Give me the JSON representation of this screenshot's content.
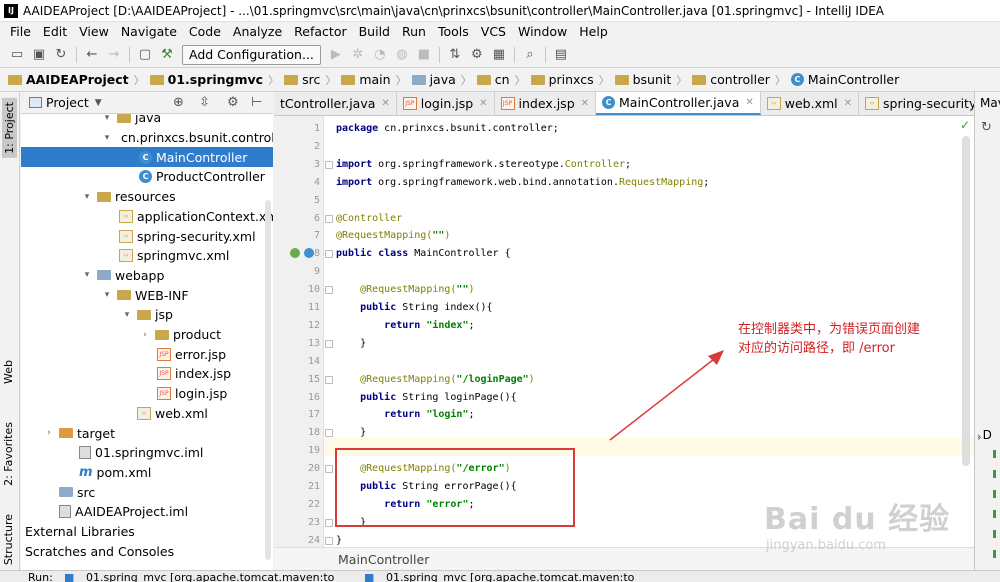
{
  "window": {
    "title": "AAIDEAProject [D:\\AAIDEAProject] - ...\\01.springmvc\\src\\main\\java\\cn\\prinxcs\\bsunit\\controller\\MainController.java [01.springmvc] - IntelliJ IDEA"
  },
  "menu": [
    "File",
    "Edit",
    "View",
    "Navigate",
    "Code",
    "Analyze",
    "Refactor",
    "Build",
    "Run",
    "Tools",
    "VCS",
    "Window",
    "Help"
  ],
  "toolbar": {
    "add_config": "Add Configuration..."
  },
  "breadcrumbs": [
    "AAIDEAProject",
    "01.springmvc",
    "src",
    "main",
    "java",
    "cn",
    "prinxcs",
    "bsunit",
    "controller",
    "MainController"
  ],
  "left_strip": {
    "project": "1: Project",
    "web": "Web",
    "favorites": "2: Favorites",
    "structure": "Z: Structure"
  },
  "project_panel": {
    "title": "Project"
  },
  "tree": [
    {
      "label": "java",
      "arrow": "▾",
      "indent": 60,
      "icon": "folder"
    },
    {
      "label": "cn.prinxcs.bsunit.controller",
      "arrow": "▾",
      "indent": 60,
      "icon": "folder"
    },
    {
      "label": "MainController",
      "arrow": "",
      "indent": 82,
      "icon": "class",
      "selected": true
    },
    {
      "label": "ProductController",
      "arrow": "",
      "indent": 82,
      "icon": "class"
    },
    {
      "label": "resources",
      "arrow": "▾",
      "indent": 40,
      "icon": "folder"
    },
    {
      "label": "applicationContext.xml",
      "arrow": "",
      "indent": 62,
      "icon": "xml"
    },
    {
      "label": "spring-security.xml",
      "arrow": "",
      "indent": 62,
      "icon": "xml"
    },
    {
      "label": "springmvc.xml",
      "arrow": "",
      "indent": 62,
      "icon": "xml"
    },
    {
      "label": "webapp",
      "arrow": "▾",
      "indent": 40,
      "icon": "folder-blue"
    },
    {
      "label": "WEB-INF",
      "arrow": "▾",
      "indent": 60,
      "icon": "folder"
    },
    {
      "label": "jsp",
      "arrow": "▾",
      "indent": 80,
      "icon": "folder"
    },
    {
      "label": "product",
      "arrow": "›",
      "indent": 98,
      "icon": "folder"
    },
    {
      "label": "error.jsp",
      "arrow": "",
      "indent": 100,
      "icon": "jsp"
    },
    {
      "label": "index.jsp",
      "arrow": "",
      "indent": 100,
      "icon": "jsp"
    },
    {
      "label": "login.jsp",
      "arrow": "",
      "indent": 100,
      "icon": "jsp"
    },
    {
      "label": "web.xml",
      "arrow": "",
      "indent": 80,
      "icon": "xml"
    },
    {
      "label": "target",
      "arrow": "›",
      "indent": 2,
      "icon": "folder-orange"
    },
    {
      "label": "01.springmvc.iml",
      "arrow": "",
      "indent": 22,
      "icon": "iml"
    },
    {
      "label": "pom.xml",
      "arrow": "",
      "indent": 22,
      "icon": "pom"
    },
    {
      "label": "src",
      "arrow": "",
      "indent": 2,
      "icon": "folder-blue"
    },
    {
      "label": "AAIDEAProject.iml",
      "arrow": "",
      "indent": 2,
      "icon": "iml"
    },
    {
      "label": "External Libraries",
      "arrow": "",
      "indent": -16,
      "icon": "none"
    },
    {
      "label": "Scratches and Consoles",
      "arrow": "",
      "indent": -16,
      "icon": "none"
    }
  ],
  "tabs": [
    {
      "label": "tController.java",
      "icon": "class",
      "active": false
    },
    {
      "label": "login.jsp",
      "icon": "jsp",
      "active": false
    },
    {
      "label": "index.jsp",
      "icon": "jsp",
      "active": false
    },
    {
      "label": "MainController.java",
      "icon": "class",
      "active": true
    },
    {
      "label": "web.xml",
      "icon": "xml",
      "active": false
    },
    {
      "label": "spring-security.xml",
      "icon": "xml",
      "active": false
    }
  ],
  "tabs_more": "≡3",
  "code": [
    "<span class=\"kw\">package</span> cn.prinxcs.bsunit.controller;",
    "",
    "<span class=\"kw\">import</span> org.springframework.stereotype.<span class=\"an\">Controller</span>;",
    "<span class=\"kw\">import</span> org.springframework.web.bind.annotation.<span class=\"an\">RequestMapping</span>;",
    "",
    "<span class=\"an\">@Controller</span>",
    "<span class=\"an\">@RequestMapping(</span><span class=\"st\">\"\"</span><span class=\"an\">)</span>",
    "<span class=\"kw\">public class</span> MainController {",
    "",
    "    <span class=\"an\">@RequestMapping(</span><span class=\"st\">\"\"</span><span class=\"an\">)</span>",
    "    <span class=\"kw\">public</span> String index(){",
    "        <span class=\"kw\">return</span> <span class=\"st\">\"index\"</span>;",
    "    }",
    "",
    "    <span class=\"an\">@RequestMapping(</span><span class=\"st\">\"/loginPage\"</span><span class=\"an\">)</span>",
    "    <span class=\"kw\">public</span> String loginPage(){",
    "        <span class=\"kw\">return</span> <span class=\"st\">\"login\"</span>;",
    "    }",
    "",
    "    <span class=\"an\">@RequestMapping(</span><span class=\"st\">\"/error\"</span><span class=\"an\">)</span>",
    "    <span class=\"kw\">public</span> String errorPage(){",
    "        <span class=\"kw\">return</span> <span class=\"st\">\"error\"</span>;",
    "    }",
    "}"
  ],
  "editor_footer": "MainController",
  "right_panel": {
    "tab": "Mav",
    "item": "D"
  },
  "bottom": {
    "run_label": "Run:",
    "run1": "01.spring_mvc [org.apache.tomcat.maven:to",
    "run2": "01.spring_mvc [org.apache.tomcat.maven:to"
  },
  "annotation": {
    "line1": "在控制器类中，为错误页面创建",
    "line2": "对应的访问路径，即 /error"
  },
  "watermark": {
    "logo": "Bai du 经验",
    "url": "jingyan.baidu.com"
  },
  "colors": {
    "selection": "#2f7ccc",
    "annotation": "#d42020",
    "keyword": "#000080",
    "string": "#008000",
    "annotation_code": "#808000"
  }
}
